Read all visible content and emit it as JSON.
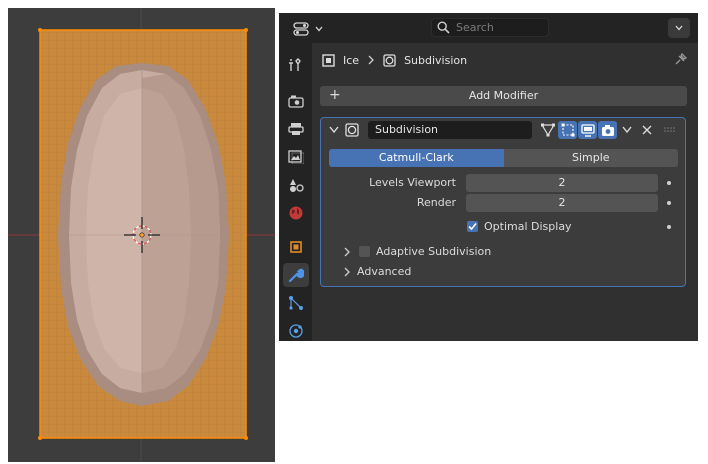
{
  "viewport": {
    "colors": {
      "background": "#3d3d3d",
      "plane": "#c98a3e",
      "selection_outline": "#ff8c00",
      "mesh": "#b89a8e"
    }
  },
  "properties": {
    "search": {
      "placeholder": "Search"
    },
    "tabs": [
      {
        "name": "tool-icon",
        "active": false
      },
      {
        "name": "render-icon",
        "active": false
      },
      {
        "name": "output-icon",
        "active": false
      },
      {
        "name": "view-layer-icon",
        "active": false
      },
      {
        "name": "scene-icon",
        "active": false
      },
      {
        "name": "world-icon",
        "active": false
      },
      {
        "name": "object-icon",
        "active": false
      },
      {
        "name": "modifier-wrench-icon",
        "active": true
      },
      {
        "name": "particles-icon",
        "active": false
      },
      {
        "name": "physics-icon",
        "active": false
      }
    ],
    "breadcrumb": {
      "object": "Ice",
      "modifier": "Subdivision"
    },
    "add_modifier": "Add Modifier",
    "modifier": {
      "name": "Subdivision",
      "type_options": [
        "Catmull-Clark",
        "Simple"
      ],
      "selected_type": "Catmull-Clark",
      "levels_viewport_label": "Levels Viewport",
      "levels_viewport": "2",
      "render_label": "Render",
      "render": "2",
      "optimal_display_label": "Optimal Display",
      "optimal_display": true,
      "adaptive_label": "Adaptive Subdivision",
      "adaptive": false,
      "advanced_label": "Advanced"
    },
    "colors": {
      "accent": "#4772b3",
      "panel": "#3c3c3c",
      "field": "#545454"
    }
  }
}
